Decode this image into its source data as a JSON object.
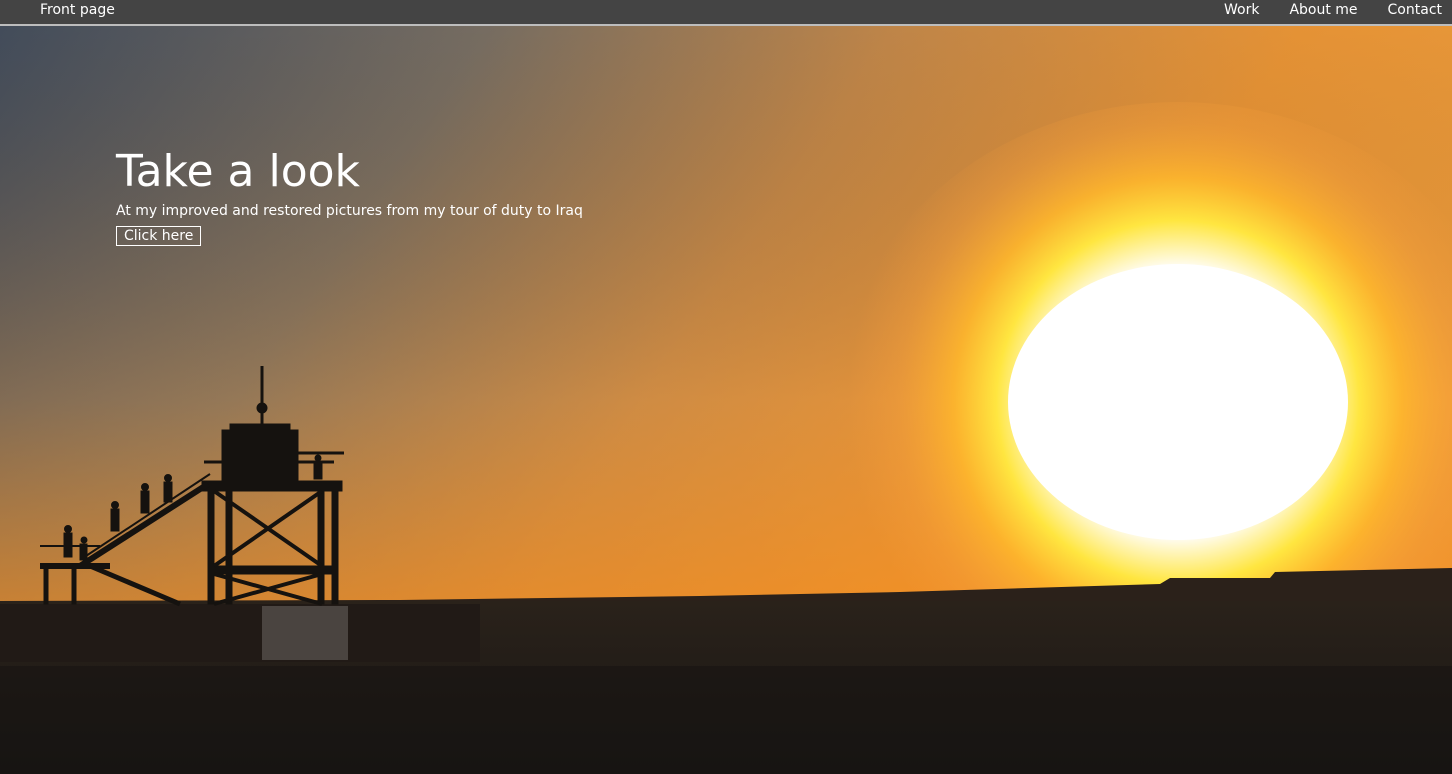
{
  "nav": {
    "brand": "Front page",
    "links": [
      {
        "label": "Work"
      },
      {
        "label": "About me"
      },
      {
        "label": "Contact"
      }
    ]
  },
  "hero": {
    "title": "Take a look",
    "subtitle": "At my improved and restored pictures from my tour of duty to Iraq",
    "button_label": "Click here"
  },
  "colors": {
    "navbar_bg": "#444444",
    "navbar_border": "#bdbdbd",
    "sky_top_left": "#4a5060",
    "sky_orange": "#f08a20",
    "sun_core": "#ffffff",
    "sun_glow": "#ffd030",
    "ground": "#1e1a16"
  }
}
